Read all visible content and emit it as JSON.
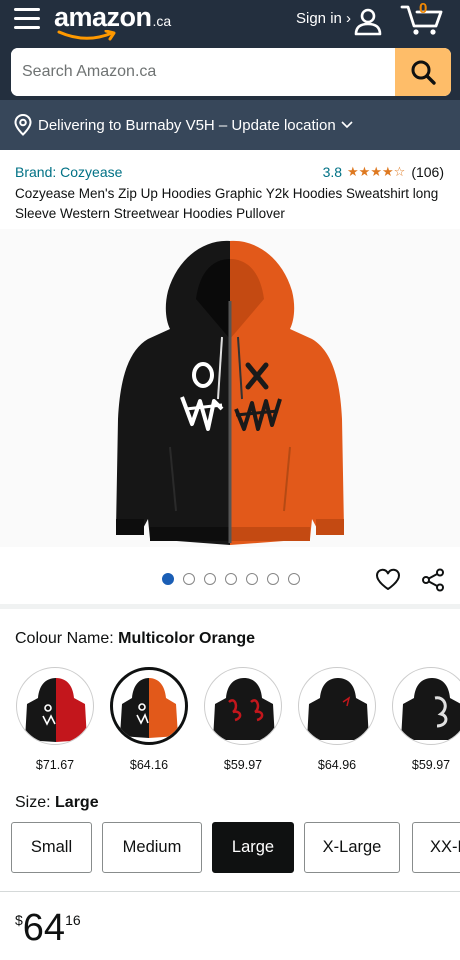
{
  "header": {
    "logo_text": "amazon",
    "logo_suffix": ".ca",
    "sign_in": "Sign in ›",
    "cart_count": "0"
  },
  "search": {
    "placeholder": "Search Amazon.ca"
  },
  "location": {
    "text": "Delivering to Burnaby V5H – Update location"
  },
  "product": {
    "brand": "Brand: Cozyease",
    "rating": "3.8",
    "stars": "★★★★☆",
    "rating_count": "(106)",
    "title": "Cozyease Men's Zip Up Hoodies Graphic Y2k Hoodies Sweatshirt long Sleeve Western Streetwear Hoodies Pullover",
    "image_count": 7,
    "active_image": 1
  },
  "colour": {
    "label": "Colour Name: ",
    "selected": "Multicolor Orange",
    "options": [
      {
        "price": "$71.67"
      },
      {
        "price": "$64.16"
      },
      {
        "price": "$59.97"
      },
      {
        "price": "$64.96"
      },
      {
        "price": "$59.97"
      }
    ]
  },
  "size": {
    "label": "Size: ",
    "selected": "Large",
    "options": [
      "Small",
      "Medium",
      "Large",
      "X-Large",
      "XX-Large"
    ]
  },
  "price": {
    "symbol": "$",
    "whole": "64",
    "fraction": "16"
  },
  "colors": {
    "header_bg": "#232f3e",
    "location_bg": "#37475a",
    "search_button": "#febd69",
    "link": "#007185",
    "star": "#de7921",
    "hoodie_orange": "#e2591a",
    "hoodie_red": "#c3161c"
  }
}
